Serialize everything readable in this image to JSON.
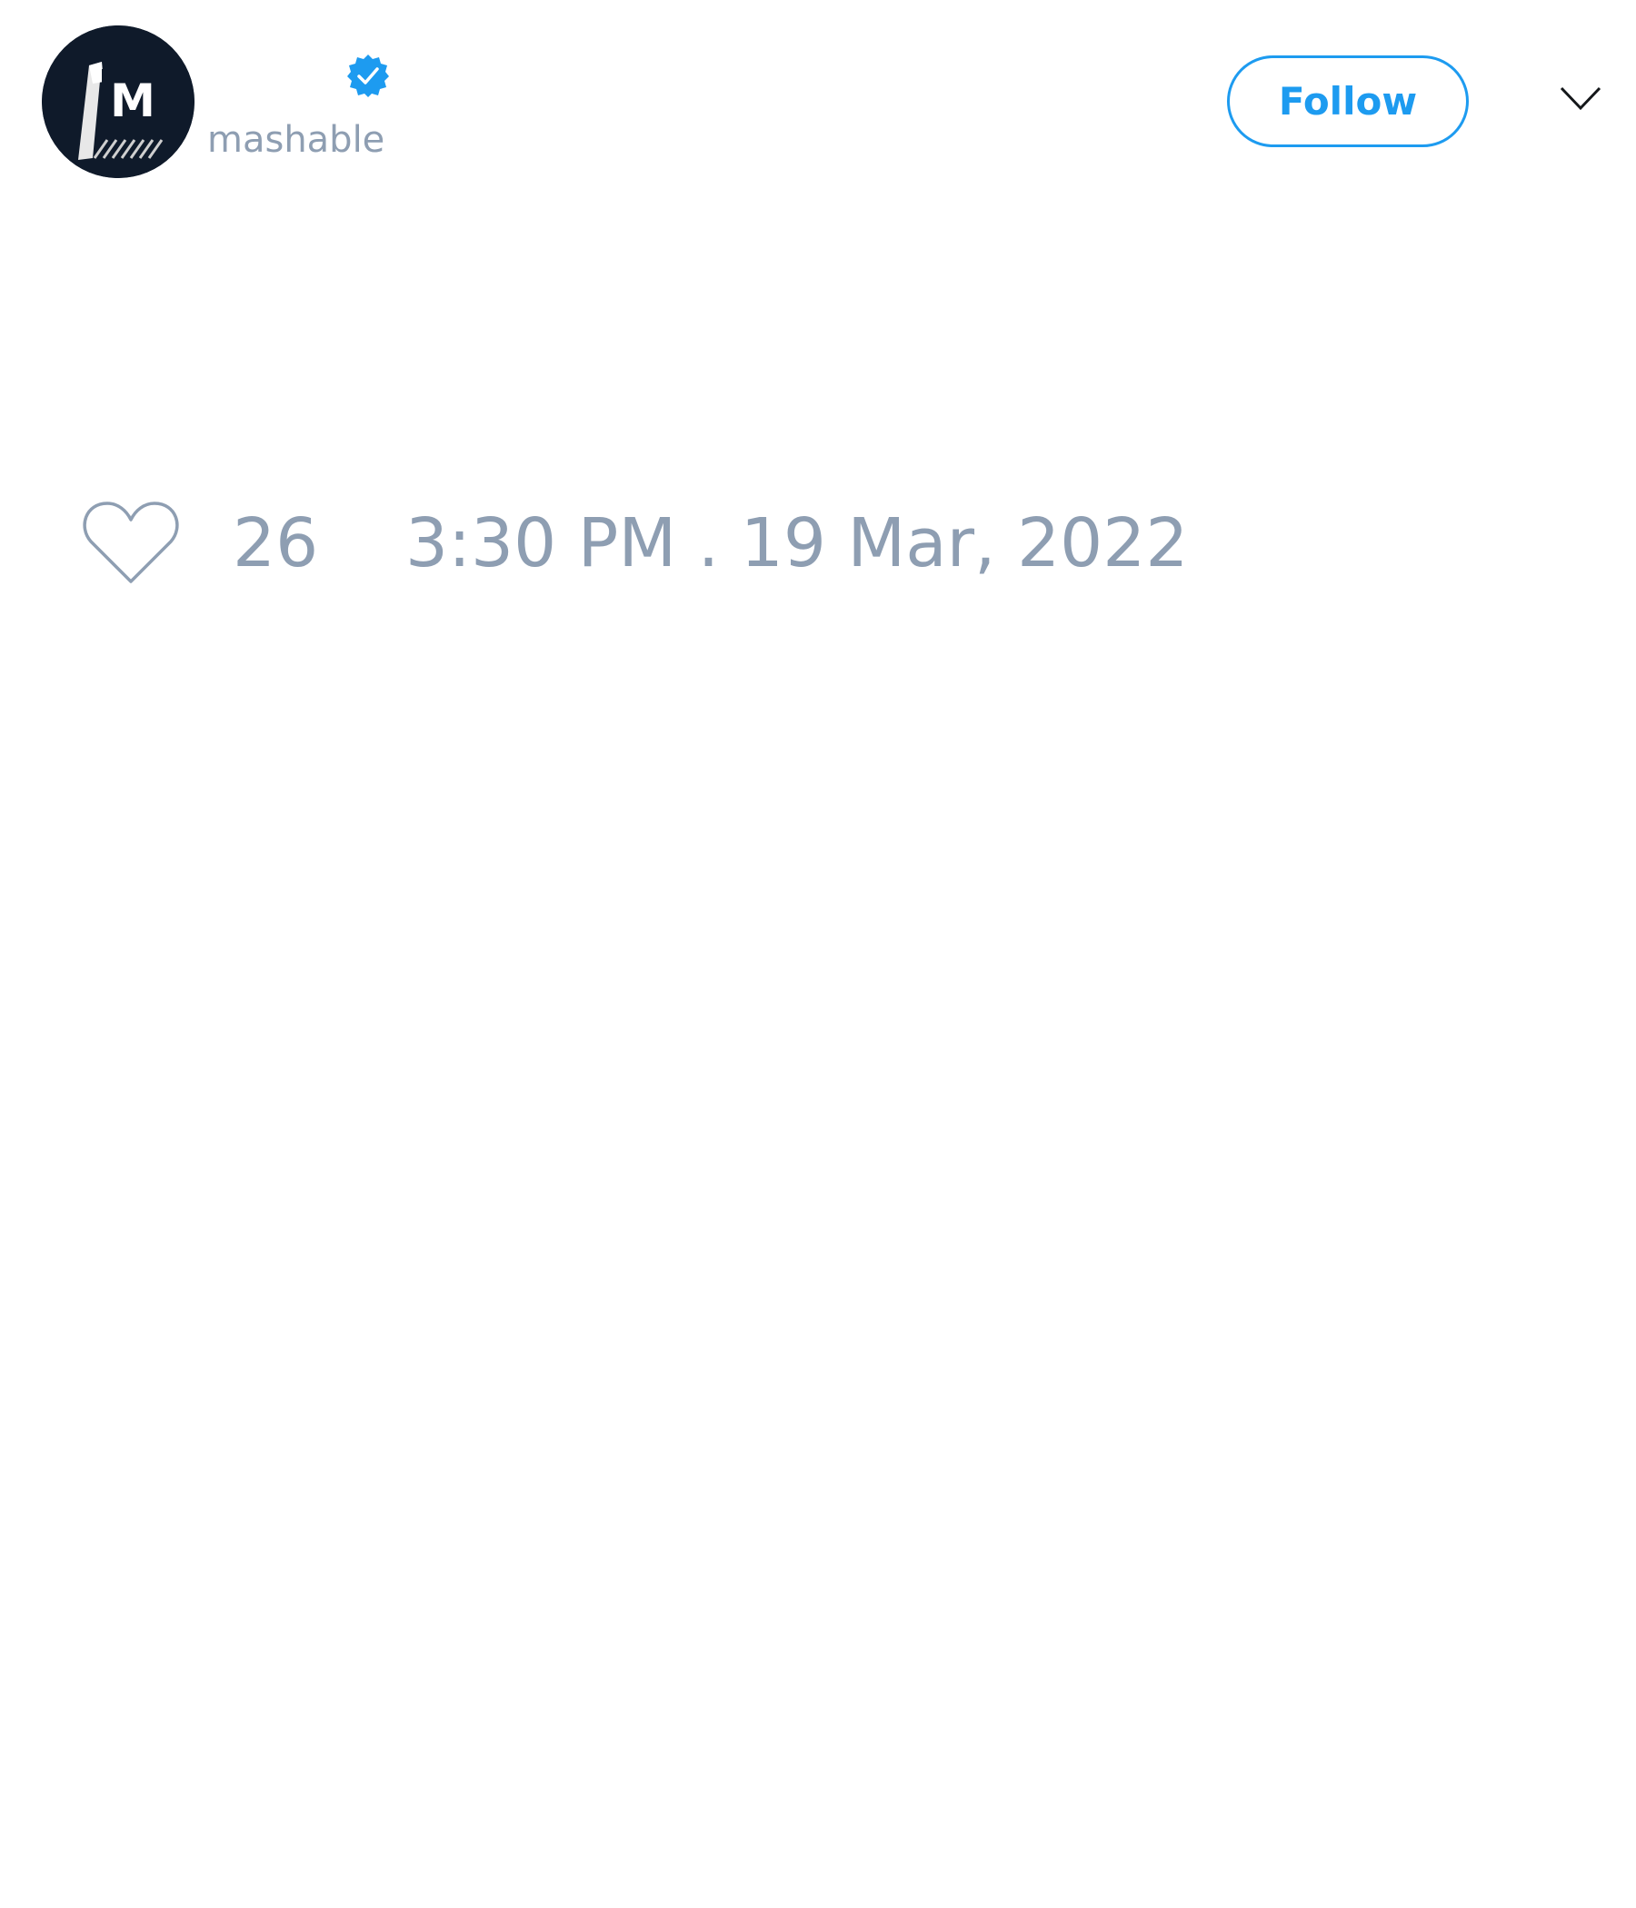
{
  "tweet": {
    "author": {
      "handle": "mashable",
      "verified": true,
      "avatar_icon": "mashable-logo-icon",
      "avatar_background": "#0f1a2a"
    },
    "follow_label": "Follow",
    "menu_icon": "chevron-down-icon",
    "likes": {
      "icon": "heart-icon",
      "count": "26"
    },
    "timestamp": "3:30 PM . 19 Mar, 2022"
  },
  "colors": {
    "accent": "#1d9bf0",
    "muted_text": "#8e9eb2",
    "background": "#ffffff"
  }
}
